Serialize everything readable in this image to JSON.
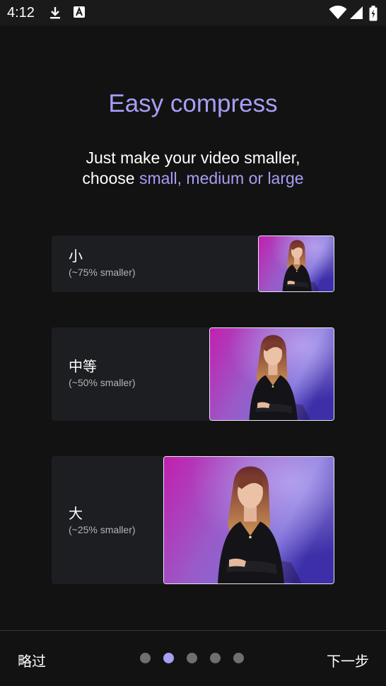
{
  "status_bar": {
    "time": "4:12",
    "icons_left": [
      "download-icon",
      "font-a-icon"
    ],
    "icons_right": [
      "wifi-icon",
      "signal-icon",
      "battery-charging-icon"
    ]
  },
  "intro": {
    "title": "Easy compress",
    "subtitle_line1": "Just make your video smaller,",
    "subtitle_line2_prefix": "choose ",
    "subtitle_line2_accent": "small, medium or large"
  },
  "options": [
    {
      "name": "小",
      "detail": "(~75% smaller)"
    },
    {
      "name": "中等",
      "detail": "(~50% smaller)"
    },
    {
      "name": "大",
      "detail": "(~25% smaller)"
    }
  ],
  "footer": {
    "skip_label": "略过",
    "next_label": "下一步",
    "page_count": 5,
    "current_page": 2
  },
  "colors": {
    "accent": "#a79ef5",
    "background": "#121212",
    "card": "#1d1e22"
  }
}
